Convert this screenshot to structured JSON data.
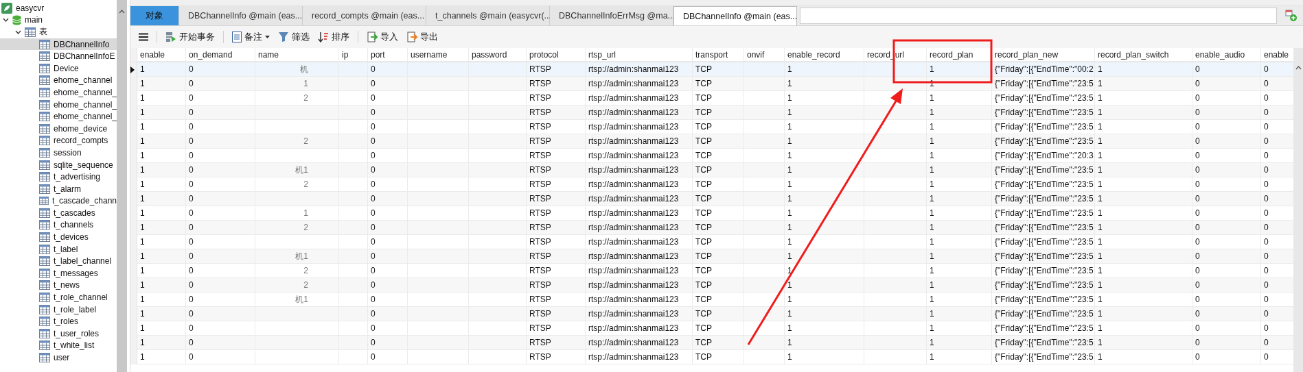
{
  "sidebar": {
    "connection": "easycvr",
    "database": "main",
    "group": "表",
    "tables": [
      {
        "label": "DBChannelInfo",
        "selected": true
      },
      {
        "label": "DBChannelInfoE",
        "selected": false
      },
      {
        "label": "Device",
        "selected": false
      },
      {
        "label": "ehome_channel",
        "selected": false
      },
      {
        "label": "ehome_channel_",
        "selected": false
      },
      {
        "label": "ehome_channel_",
        "selected": false
      },
      {
        "label": "ehome_channel_",
        "selected": false
      },
      {
        "label": "ehome_device",
        "selected": false
      },
      {
        "label": "record_compts",
        "selected": false
      },
      {
        "label": "session",
        "selected": false
      },
      {
        "label": "sqlite_sequence",
        "selected": false
      },
      {
        "label": "t_advertising",
        "selected": false
      },
      {
        "label": "t_alarm",
        "selected": false
      },
      {
        "label": "t_cascade_chann",
        "selected": false
      },
      {
        "label": "t_cascades",
        "selected": false
      },
      {
        "label": "t_channels",
        "selected": false
      },
      {
        "label": "t_devices",
        "selected": false
      },
      {
        "label": "t_label",
        "selected": false
      },
      {
        "label": "t_label_channel",
        "selected": false
      },
      {
        "label": "t_messages",
        "selected": false
      },
      {
        "label": "t_news",
        "selected": false
      },
      {
        "label": "t_role_channel",
        "selected": false
      },
      {
        "label": "t_role_label",
        "selected": false
      },
      {
        "label": "t_roles",
        "selected": false
      },
      {
        "label": "t_user_roles",
        "selected": false
      },
      {
        "label": "t_white_list",
        "selected": false
      },
      {
        "label": "user",
        "selected": false
      }
    ]
  },
  "tabs": [
    {
      "label": "对象",
      "kind": "objects",
      "selected": false
    },
    {
      "label": "DBChannelInfo @main (eas...",
      "kind": "table",
      "selected": false
    },
    {
      "label": "record_compts @main (eas...",
      "kind": "table",
      "selected": false
    },
    {
      "label": "t_channels @main (easycvr(...",
      "kind": "table",
      "selected": false
    },
    {
      "label": "DBChannelInfoErrMsg @ma...",
      "kind": "table",
      "selected": false
    },
    {
      "label": "DBChannelInfo @main (eas...",
      "kind": "table",
      "selected": true
    }
  ],
  "toolbar": [
    {
      "label": "开始事务",
      "kind": "transaction"
    },
    {
      "label": "备注",
      "kind": "memo"
    },
    {
      "label": "筛选",
      "kind": "filter"
    },
    {
      "label": "排序",
      "kind": "sort"
    },
    {
      "label": "导入",
      "kind": "import"
    },
    {
      "label": "导出",
      "kind": "export"
    }
  ],
  "table": {
    "columns": [
      "enable",
      "on_demand",
      "name",
      "ip",
      "port",
      "username",
      "password",
      "protocol",
      "rtsp_url",
      "transport",
      "onvif",
      "enable_record",
      "record_url",
      "record_plan",
      "record_plan_new",
      "record_plan_switch",
      "enable_audio",
      "enable"
    ],
    "rows": [
      {
        "selected": true,
        "cells": [
          "1",
          "0",
          "机",
          null,
          "0",
          null,
          null,
          "RTSP",
          "rtsp://admin:shanmai123",
          "TCP",
          null,
          "1",
          null,
          "1",
          "{\"Friday\":[{\"EndTime\":\"00:2",
          "1",
          "0",
          "0"
        ]
      },
      {
        "selected": false,
        "cells": [
          "1",
          "0",
          "1",
          null,
          "0",
          null,
          null,
          "RTSP",
          "rtsp://admin:shanmai123",
          "TCP",
          null,
          "1",
          null,
          "1",
          "{\"Friday\":[{\"EndTime\":\"23:5",
          "1",
          "0",
          "0"
        ]
      },
      {
        "selected": false,
        "cells": [
          "1",
          "0",
          "2",
          null,
          "0",
          null,
          null,
          "RTSP",
          "rtsp://admin:shanmai123",
          "TCP",
          null,
          "1",
          null,
          "1",
          "{\"Friday\":[{\"EndTime\":\"23:5",
          "1",
          "0",
          "0"
        ]
      },
      {
        "selected": false,
        "cells": [
          "1",
          "0",
          null,
          null,
          "0",
          null,
          null,
          "RTSP",
          "rtsp://admin:shanmai123",
          "TCP",
          null,
          "1",
          null,
          "1",
          "{\"Friday\":[{\"EndTime\":\"23:5",
          "1",
          "0",
          "0"
        ]
      },
      {
        "selected": false,
        "cells": [
          "1",
          "0",
          null,
          null,
          "0",
          null,
          null,
          "RTSP",
          "rtsp://admin:shanmai123",
          "TCP",
          null,
          "1",
          null,
          "1",
          "{\"Friday\":[{\"EndTime\":\"23:5",
          "1",
          "0",
          "0"
        ]
      },
      {
        "selected": false,
        "cells": [
          "1",
          "0",
          "2",
          null,
          "0",
          null,
          null,
          "RTSP",
          "rtsp://admin:shanmai123",
          "TCP",
          null,
          "1",
          null,
          "1",
          "{\"Friday\":[{\"EndTime\":\"23:5",
          "1",
          "0",
          "0"
        ]
      },
      {
        "selected": false,
        "cells": [
          "1",
          "0",
          null,
          null,
          "0",
          null,
          null,
          "RTSP",
          "rtsp://admin:shanmai123",
          "TCP",
          null,
          "1",
          null,
          "1",
          "{\"Friday\":[{\"EndTime\":\"20:3",
          "1",
          "0",
          "0"
        ]
      },
      {
        "selected": false,
        "cells": [
          "1",
          "0",
          "机1",
          null,
          "0",
          null,
          null,
          "RTSP",
          "rtsp://admin:shanmai123",
          "TCP",
          null,
          "1",
          null,
          "1",
          "{\"Friday\":[{\"EndTime\":\"23:5",
          "1",
          "0",
          "0"
        ]
      },
      {
        "selected": false,
        "cells": [
          "1",
          "0",
          "2",
          null,
          "0",
          null,
          null,
          "RTSP",
          "rtsp://admin:shanmai123",
          "TCP",
          null,
          "1",
          null,
          "1",
          "{\"Friday\":[{\"EndTime\":\"23:5",
          "1",
          "0",
          "0"
        ]
      },
      {
        "selected": false,
        "cells": [
          "1",
          "0",
          null,
          null,
          "0",
          null,
          null,
          "RTSP",
          "rtsp://admin:shanmai123",
          "TCP",
          null,
          "1",
          null,
          "1",
          "{\"Friday\":[{\"EndTime\":\"23:5",
          "1",
          "0",
          "0"
        ]
      },
      {
        "selected": false,
        "cells": [
          "1",
          "0",
          "1",
          null,
          "0",
          null,
          null,
          "RTSP",
          "rtsp://admin:shanmai123",
          "TCP",
          null,
          "1",
          null,
          "1",
          "{\"Friday\":[{\"EndTime\":\"23:5",
          "1",
          "0",
          "0"
        ]
      },
      {
        "selected": false,
        "cells": [
          "1",
          "0",
          "2",
          null,
          "0",
          null,
          null,
          "RTSP",
          "rtsp://admin:shanmai123",
          "TCP",
          null,
          "1",
          null,
          "1",
          "{\"Friday\":[{\"EndTime\":\"23:5",
          "1",
          "0",
          "0"
        ]
      },
      {
        "selected": false,
        "cells": [
          "1",
          "0",
          null,
          null,
          "0",
          null,
          null,
          "RTSP",
          "rtsp://admin:shanmai123",
          "TCP",
          null,
          "1",
          null,
          "1",
          "{\"Friday\":[{\"EndTime\":\"23:5",
          "1",
          "0",
          "0"
        ]
      },
      {
        "selected": false,
        "cells": [
          "1",
          "0",
          "机1",
          null,
          "0",
          null,
          null,
          "RTSP",
          "rtsp://admin:shanmai123",
          "TCP",
          null,
          "1",
          null,
          "1",
          "{\"Friday\":[{\"EndTime\":\"23:5",
          "1",
          "0",
          "0"
        ]
      },
      {
        "selected": false,
        "cells": [
          "1",
          "0",
          "2",
          null,
          "0",
          null,
          null,
          "RTSP",
          "rtsp://admin:shanmai123",
          "TCP",
          null,
          "1",
          null,
          "1",
          "{\"Friday\":[{\"EndTime\":\"23:5",
          "1",
          "0",
          "0"
        ]
      },
      {
        "selected": false,
        "cells": [
          "1",
          "0",
          "2",
          null,
          "0",
          null,
          null,
          "RTSP",
          "rtsp://admin:shanmai123",
          "TCP",
          null,
          "1",
          null,
          "1",
          "{\"Friday\":[{\"EndTime\":\"23:5",
          "1",
          "0",
          "0"
        ]
      },
      {
        "selected": false,
        "cells": [
          "1",
          "0",
          "机1",
          null,
          "0",
          null,
          null,
          "RTSP",
          "rtsp://admin:shanmai123",
          "TCP",
          null,
          "1",
          null,
          "1",
          "{\"Friday\":[{\"EndTime\":\"23:5",
          "1",
          "0",
          "0"
        ]
      },
      {
        "selected": false,
        "cells": [
          "1",
          "0",
          null,
          null,
          "0",
          null,
          null,
          "RTSP",
          "rtsp://admin:shanmai123",
          "TCP",
          null,
          "1",
          null,
          "1",
          "{\"Friday\":[{\"EndTime\":\"23:5",
          "1",
          "0",
          "0"
        ]
      },
      {
        "selected": false,
        "cells": [
          "1",
          "0",
          null,
          null,
          "0",
          null,
          null,
          "RTSP",
          "rtsp://admin:shanmai123",
          "TCP",
          null,
          "1",
          null,
          "1",
          "{\"Friday\":[{\"EndTime\":\"23:5",
          "1",
          "0",
          "0"
        ]
      },
      {
        "selected": false,
        "cells": [
          "1",
          "0",
          null,
          null,
          "0",
          null,
          null,
          "RTSP",
          "rtsp://admin:shanmai123",
          "TCP",
          null,
          "1",
          null,
          "1",
          "{\"Friday\":[{\"EndTime\":\"23:5",
          "1",
          "0",
          "0"
        ]
      },
      {
        "selected": false,
        "cells": [
          "1",
          "0",
          null,
          null,
          "0",
          null,
          null,
          "RTSP",
          "rtsp://admin:shanmai123",
          "TCP",
          null,
          "1",
          null,
          "1",
          "{\"Friday\":[{\"EndTime\":\"23:5",
          "1",
          "0",
          "0"
        ]
      }
    ]
  }
}
